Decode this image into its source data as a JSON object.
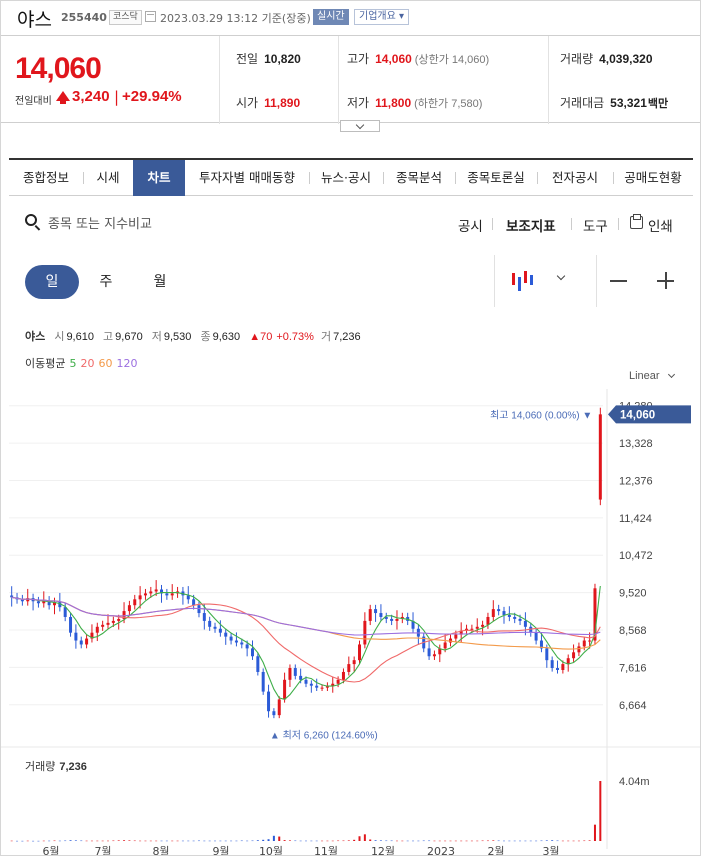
{
  "header": {
    "stock_name": "야스",
    "stock_code": "255440",
    "market": "코스닥",
    "timestamp": "2023.03.29 13:12 기준(장중)",
    "realtime_badge": "실시간",
    "company_button": "기업개요"
  },
  "summary": {
    "current_price": "14,060",
    "change_label": "전일대비",
    "change_value": "3,240",
    "change_pct": "+29.94%",
    "quotes": [
      {
        "label": "전일",
        "value": "10,820",
        "extra": "",
        "color": "dark"
      },
      {
        "label": "고가",
        "value": "14,060",
        "extra": "(상한가 14,060)",
        "color": "red"
      },
      {
        "label": "거래량",
        "value": "4,039,320",
        "extra": "",
        "color": "dark"
      },
      {
        "label": "시가",
        "value": "11,890",
        "extra": "",
        "color": "red"
      },
      {
        "label": "저가",
        "value": "11,800",
        "extra": "(하한가 7,580)",
        "color": "red"
      },
      {
        "label": "거래대금",
        "value": "53,321",
        "extra": "백만",
        "color": "dark"
      }
    ]
  },
  "tabs": [
    "종합정보",
    "시세",
    "차트",
    "투자자별 매매동향",
    "뉴스·공시",
    "종목분석",
    "종목토론실",
    "전자공시",
    "공매도현황"
  ],
  "active_tab": "차트",
  "search": {
    "placeholder": "종목 또는 지수비교"
  },
  "tools": {
    "disclosure": "공시",
    "indicators": "보조지표",
    "tools": "도구",
    "print": "인쇄"
  },
  "periods": [
    "일",
    "주",
    "월"
  ],
  "active_period": "일",
  "ohlc_info": {
    "name": "야스",
    "open_label": "시",
    "open": "9,610",
    "high_label": "고",
    "high": "9,670",
    "low_label": "저",
    "low": "9,530",
    "close_label": "종",
    "close": "9,630",
    "change": "▲70",
    "change_pct": "+0.73%",
    "volume_label": "거",
    "volume": "7,236"
  },
  "ma_legend": {
    "label": "이동평균",
    "items": [
      {
        "period": "5",
        "color": "#3fae49"
      },
      {
        "period": "20",
        "color": "#f06a6a"
      },
      {
        "period": "60",
        "color": "#f39a4a"
      },
      {
        "period": "120",
        "color": "#9b6fe0"
      }
    ]
  },
  "scale": "Linear",
  "volume_info": {
    "label": "거래량",
    "value": "7,236"
  },
  "chart_data": {
    "type": "candlestick",
    "x_ticks": [
      "6월",
      "7월",
      "8월",
      "9월",
      "10월",
      "11월",
      "12월",
      "2023",
      "2월",
      "3월"
    ],
    "y_ticks": [
      14280,
      13328,
      12376,
      11424,
      10472,
      9520,
      8568,
      7616,
      6664
    ],
    "ylim": [
      6200,
      14400
    ],
    "price_tag": "14,060",
    "high_annotation": "최고 14,060 (0.00%)",
    "low_annotation": "최저 6,260 (124.60%)",
    "volume_max_label": "4.04m",
    "closes": [
      9400,
      9350,
      9300,
      9380,
      9300,
      9250,
      9320,
      9200,
      9280,
      9150,
      8900,
      8500,
      8300,
      8200,
      8350,
      8500,
      8650,
      8700,
      8750,
      8800,
      8850,
      9050,
      9200,
      9350,
      9450,
      9500,
      9550,
      9600,
      9500,
      9450,
      9500,
      9550,
      9450,
      9350,
      9200,
      9000,
      8800,
      8650,
      8600,
      8500,
      8400,
      8300,
      8250,
      8200,
      8100,
      7900,
      7500,
      7000,
      6500,
      6400,
      6800,
      7300,
      7600,
      7400,
      7300,
      7200,
      7150,
      7100,
      7100,
      7150,
      7200,
      7300,
      7500,
      7700,
      7800,
      8200,
      8800,
      9100,
      9000,
      8900,
      8850,
      8800,
      8850,
      8900,
      8800,
      8600,
      8400,
      8100,
      7900,
      7950,
      8100,
      8250,
      8350,
      8450,
      8550,
      8600,
      8600,
      8650,
      8700,
      8900,
      9100,
      9050,
      8950,
      8900,
      8850,
      8800,
      8650,
      8500,
      8300,
      8100,
      7800,
      7600,
      7550,
      7700,
      7850,
      8000,
      8150,
      8300,
      8300,
      9630,
      14060
    ],
    "volumes": [
      0.02,
      0.01,
      0.01,
      0.02,
      0.01,
      0.01,
      0.02,
      0.02,
      0.03,
      0.02,
      0.03,
      0.05,
      0.04,
      0.03,
      0.02,
      0.02,
      0.02,
      0.02,
      0.02,
      0.03,
      0.04,
      0.05,
      0.04,
      0.03,
      0.02,
      0.02,
      0.02,
      0.02,
      0.02,
      0.02,
      0.02,
      0.02,
      0.02,
      0.02,
      0.02,
      0.03,
      0.02,
      0.02,
      0.02,
      0.02,
      0.02,
      0.02,
      0.02,
      0.03,
      0.02,
      0.03,
      0.05,
      0.08,
      0.12,
      0.35,
      0.3,
      0.06,
      0.04,
      0.03,
      0.02,
      0.02,
      0.02,
      0.02,
      0.02,
      0.02,
      0.02,
      0.03,
      0.03,
      0.04,
      0.08,
      0.32,
      0.45,
      0.1,
      0.05,
      0.04,
      0.03,
      0.03,
      0.02,
      0.02,
      0.02,
      0.02,
      0.02,
      0.03,
      0.03,
      0.02,
      0.02,
      0.02,
      0.02,
      0.02,
      0.02,
      0.02,
      0.02,
      0.02,
      0.03,
      0.03,
      0.04,
      0.03,
      0.02,
      0.02,
      0.02,
      0.02,
      0.02,
      0.02,
      0.02,
      0.03,
      0.04,
      0.05,
      0.03,
      0.02,
      0.02,
      0.02,
      0.02,
      0.03,
      0.04,
      1.1,
      4.04
    ]
  }
}
